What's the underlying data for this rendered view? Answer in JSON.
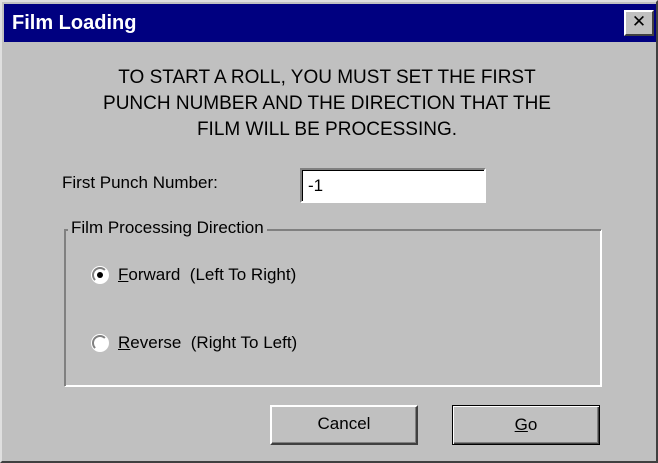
{
  "window": {
    "title": "Film Loading",
    "close_glyph": "✕"
  },
  "message": "TO START A ROLL, YOU MUST SET THE FIRST\nPUNCH NUMBER AND THE DIRECTION THAT THE\nFILM WILL BE PROCESSING.",
  "punch_field": {
    "label": "First Punch Number:",
    "value": "-1"
  },
  "direction_group": {
    "legend": "Film Processing Direction",
    "options": [
      {
        "mnemonic": "F",
        "rest": "orward",
        "hint": "  (Left To Right)",
        "selected": true
      },
      {
        "mnemonic": "R",
        "rest": "everse",
        "hint": "  (Right To Left)",
        "selected": false
      }
    ]
  },
  "buttons": {
    "cancel": "Cancel",
    "go_mnemonic": "G",
    "go_rest": "o"
  }
}
